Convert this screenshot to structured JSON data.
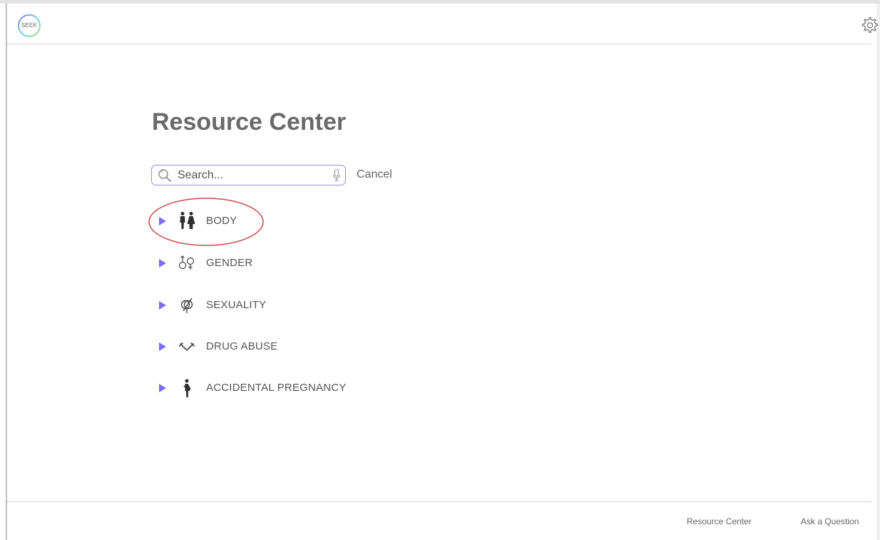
{
  "header": {
    "logo_text": "SEEK",
    "settings_icon": "gear-icon"
  },
  "main": {
    "title": "Resource Center",
    "search": {
      "placeholder": "Search...",
      "value": "",
      "search_icon": "search-icon",
      "mic_icon": "microphone-icon",
      "cancel_label": "Cancel"
    },
    "categories": [
      {
        "label": "BODY",
        "icon": "people-icon"
      },
      {
        "label": "GENDER",
        "icon": "gender-symbols-icon"
      },
      {
        "label": "SEXUALITY",
        "icon": "sexuality-symbol-icon"
      },
      {
        "label": "DRUG ABUSE",
        "icon": "syringe-icon"
      },
      {
        "label": "ACCIDENTAL PREGNANCY",
        "icon": "pregnant-person-icon"
      }
    ],
    "expand_icon": "triangle-right-icon"
  },
  "footer": {
    "links": [
      "Resource Center",
      "Ask a Question"
    ]
  },
  "colors": {
    "accent": "#7b6ff0",
    "highlight_ring": "#c94a4a",
    "title": "#6a6a6a"
  }
}
